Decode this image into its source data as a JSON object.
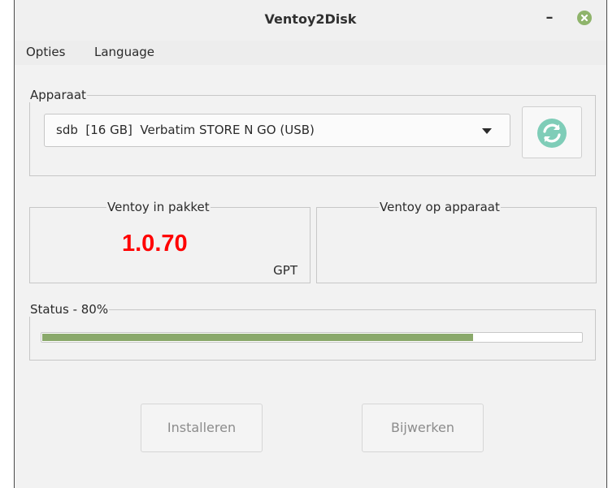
{
  "window": {
    "title": "Ventoy2Disk"
  },
  "menu": {
    "items": [
      "Opties",
      "Language"
    ]
  },
  "device": {
    "group_label": "Apparaat",
    "selected": "sdb  [16 GB]  Verbatim STORE N GO (USB)",
    "refresh_icon": "refresh-icon"
  },
  "package": {
    "label": "Ventoy in pakket",
    "version": "1.0.70",
    "partition_style": "GPT"
  },
  "on_device": {
    "label": "Ventoy op apparaat",
    "version": ""
  },
  "status": {
    "label": "Status - 80%",
    "progress": 0.8
  },
  "buttons": {
    "install": "Installeren",
    "update": "Bijwerken"
  },
  "colors": {
    "accent": "#8aa96b",
    "version": "#ff0000",
    "close": "#8fb46b"
  }
}
